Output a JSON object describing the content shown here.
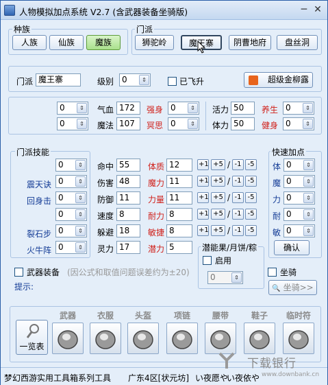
{
  "window": {
    "title": "人物模拟加点系统 V2.7 (含武器装备坐骑版)",
    "minimize": "─",
    "close": "✕"
  },
  "race": {
    "group_label": "种族",
    "options": [
      "人族",
      "仙族",
      "魔族"
    ],
    "selected": "魔族"
  },
  "sect_group": {
    "group_label": "门派",
    "options": [
      "狮驼岭",
      "魔王寨",
      "阴曹地府",
      "盘丝洞"
    ],
    "selected": "魔王寨"
  },
  "info": {
    "sect_label": "门派",
    "sect_value": "魔王寨",
    "level_label": "级别",
    "level_value": "0",
    "flying_label": "已飞升",
    "golden_button": "超级金柳露"
  },
  "skills": {
    "left_spins": [
      "0",
      "0"
    ],
    "qixue_label": "气血",
    "qixue_value": "172",
    "qiangshen_label": "强身",
    "qiangshen_value": "0",
    "fali_label": "魔法",
    "fali_value": "107",
    "mingsi_label": "冥思",
    "mingsi_value": "0",
    "huoli_label": "活力",
    "huoli_value": "50",
    "yangsheng_label": "养生",
    "yangsheng_value": "0",
    "tili_label": "体力",
    "tili_value": "50",
    "jianshen_label": "健身",
    "jianshen_value": "0"
  },
  "sect_skills": {
    "group_label": "门派技能",
    "names": [
      "",
      "震天诀",
      "回身击",
      "",
      "裂石步",
      "火牛阵"
    ],
    "values": [
      "0",
      "0",
      "0",
      "0",
      "0",
      "0"
    ]
  },
  "stats": {
    "rows": [
      {
        "label": "命中",
        "value": "55",
        "attr": "体质",
        "attr_value": "12"
      },
      {
        "label": "伤害",
        "value": "48",
        "attr": "魔力",
        "attr_value": "11"
      },
      {
        "label": "防御",
        "value": "11",
        "attr": "力量",
        "attr_value": "11"
      },
      {
        "label": "速度",
        "value": "8",
        "attr": "耐力",
        "attr_value": "8"
      },
      {
        "label": "躲避",
        "value": "18",
        "attr": "敏捷",
        "attr_value": "8"
      },
      {
        "label": "灵力",
        "value": "17",
        "attr": "潜力",
        "attr_value": "5"
      }
    ],
    "buttons": [
      "+1",
      "+5",
      "/",
      "-1",
      "-5"
    ]
  },
  "potential_fruit": {
    "label": "潜能果/月饼/粽",
    "enable_label": "启用",
    "value": "0"
  },
  "quick_points": {
    "group_label": "快速加点",
    "labels": [
      "体",
      "魔",
      "力",
      "耐",
      "敏"
    ],
    "values": [
      "0",
      "0",
      "0",
      "0",
      "0"
    ],
    "confirm": "确认"
  },
  "weapon": {
    "checkbox_label": "武器装备",
    "note": "(因公式和取值问题误差约为±20)",
    "hint_label": "提示:"
  },
  "mount": {
    "checkbox_label": "坐骑",
    "button": "坐骑>>"
  },
  "equipment": {
    "overview_button": "一览表",
    "slots": [
      "武器",
      "衣服",
      "头盔",
      "项链",
      "腰带",
      "鞋子",
      "临时符"
    ]
  },
  "status": {
    "left": "梦幻西游实用工具箱系列工具",
    "server": "广东4区[状元坊]",
    "text": "い夜愿や",
    "text2": "い夜依や"
  },
  "watermark": {
    "brand": "下载银行",
    "url": "www.downbank.cn"
  }
}
